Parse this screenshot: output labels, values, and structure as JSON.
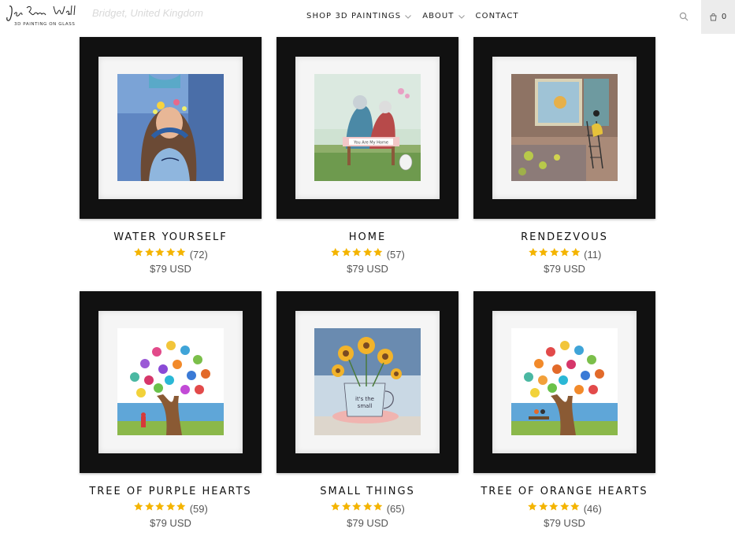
{
  "header": {
    "logo_text": "Jen Ramm Wall",
    "logo_subtitle": "3D PAINTING ON GLASS",
    "faded_location": "Bridget, United Kingdom",
    "nav": [
      {
        "label": "SHOP 3D PAINTINGS",
        "has_dropdown": true
      },
      {
        "label": "ABOUT",
        "has_dropdown": true
      },
      {
        "label": "CONTACT",
        "has_dropdown": false
      }
    ],
    "search_icon": "search-icon",
    "cart_icon": "cart-icon",
    "cart_count": "0"
  },
  "colors": {
    "star": "#f4b400",
    "frame": "#111111",
    "cart_bg": "#ececec"
  },
  "products": [
    {
      "title": "WATER YOURSELF",
      "stars": 5,
      "reviews": "(72)",
      "price": "$79 USD"
    },
    {
      "title": "HOME",
      "stars": 5,
      "reviews": "(57)",
      "price": "$79 USD"
    },
    {
      "title": "RENDEZVOUS",
      "stars": 5,
      "reviews": "(11)",
      "price": "$79 USD"
    },
    {
      "title": "TREE OF PURPLE HEARTS",
      "stars": 5,
      "reviews": "(59)",
      "price": "$79 USD"
    },
    {
      "title": "SMALL THINGS",
      "stars": 5,
      "reviews": "(65)",
      "price": "$79 USD"
    },
    {
      "title": "TREE OF ORANGE HEARTS",
      "stars": 5,
      "reviews": "(46)",
      "price": "$79 USD"
    }
  ]
}
